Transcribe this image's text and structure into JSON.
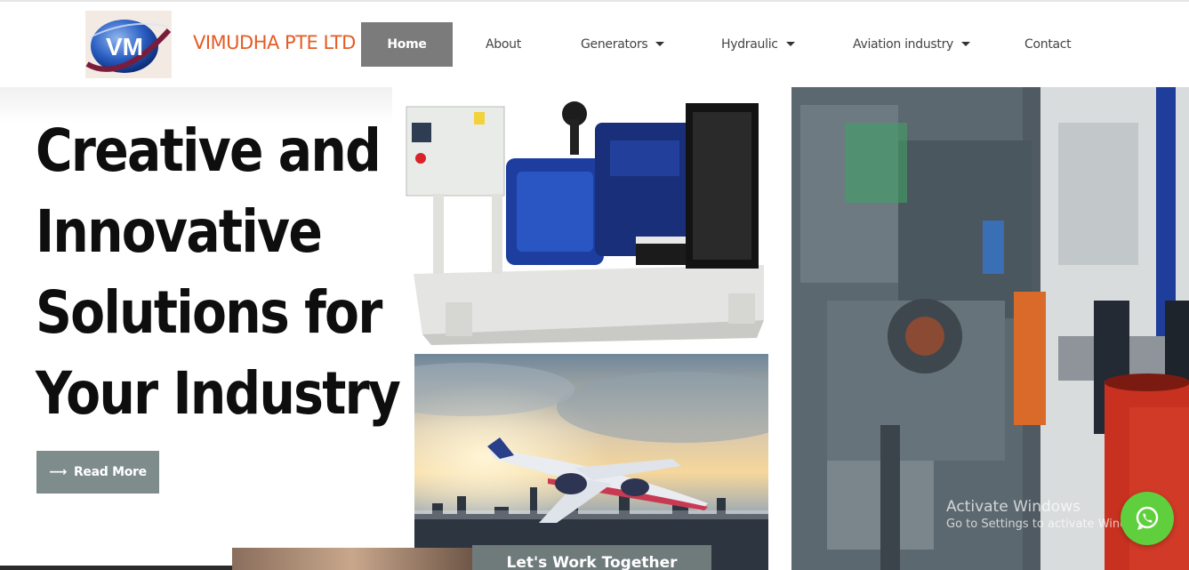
{
  "header": {
    "logo_text": "VM",
    "brand": "VIMUDHA PTE LTD",
    "nav": [
      {
        "label": "Home",
        "active": true,
        "dropdown": false
      },
      {
        "label": "About",
        "active": false,
        "dropdown": false
      },
      {
        "label": "Generators",
        "active": false,
        "dropdown": true
      },
      {
        "label": "Hydraulic",
        "active": false,
        "dropdown": true
      },
      {
        "label": "Aviation industry",
        "active": false,
        "dropdown": true
      },
      {
        "label": "Contact",
        "active": false,
        "dropdown": false
      }
    ]
  },
  "hero": {
    "title_lines": [
      "Creative and",
      "Innovative",
      "Solutions for",
      "Your Industry"
    ],
    "button_label": "Read More",
    "button_icon": "arrow-right-icon"
  },
  "section": {
    "band_label": "Let's Work Together"
  },
  "watermark": {
    "line1": "Activate Windows",
    "line2": "Go to Settings to activate Windows."
  },
  "colors": {
    "brand": "#e55b24",
    "nav_active_bg": "#7b7b7b",
    "button_bg": "#7f8c8c",
    "whatsapp": "#5fcf3e"
  },
  "icons": {
    "whatsapp": "whatsapp-icon"
  }
}
